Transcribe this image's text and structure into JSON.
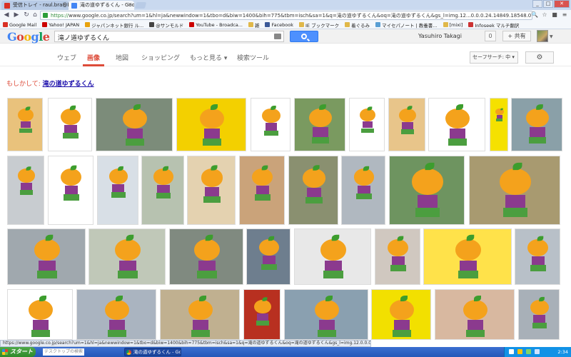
{
  "browser": {
    "tabs": [
      {
        "label": "受信トレイ - raul.bra@biglobe..."
      },
      {
        "label": "滝の道ゆずるくん - Google 画像..."
      }
    ],
    "url_scheme": "https://",
    "url_rest": "www.google.co.jp/search?um=1&hl=ja&newwindow=1&tbo=d&biw=1400&bih=775&tbm=isch&sa=1&q=滝の道ゆずるくん&oq=滝の道ゆずるくん&gs_l=img.12...0.0.0.24.14849.18548.0.21.0.15.11.11.0.0.0.0.077.671.11.11.0...0.0...",
    "bookmarks": [
      {
        "label": "Google Mail",
        "color": "#d93025"
      },
      {
        "label": "Yahoo! JAPAN",
        "color": "#cc0000"
      },
      {
        "label": "ジャパンネット銀行 ル...",
        "color": "#e8a30f"
      },
      {
        "label": "@サンモルド",
        "color": "#444444"
      },
      {
        "label": "YouTube - Broadca...",
        "color": "#cc0000"
      },
      {
        "label": "雑",
        "color": "#e0b84a"
      },
      {
        "label": "Facebook",
        "color": "#3b5998"
      },
      {
        "label": "IE ブックマーク",
        "color": "#e0b84a"
      },
      {
        "label": "着ぐるみ",
        "color": "#e0b84a"
      },
      {
        "label": "マイセパノート | 教養書...",
        "color": "#5a9fd4"
      },
      {
        "label": "[mixi]",
        "color": "#e0b84a"
      },
      {
        "label": "Infoseek マルチ翻訳",
        "color": "#cc3333"
      }
    ]
  },
  "google": {
    "logo": "Google",
    "query": "滝ノ道ゆずるくん",
    "username": "Yasuhiro Takagi",
    "notification_count": "0",
    "share_label": "+ 共有",
    "tabs": [
      {
        "label": "ウェブ"
      },
      {
        "label": "画像"
      },
      {
        "label": "地図"
      },
      {
        "label": "ショッピング"
      },
      {
        "label": "もっと見る ▾"
      },
      {
        "label": "検索ツール"
      }
    ],
    "safesearch_label": "セーフサーチ: 中 ▾",
    "did_you_mean_prefix": "もしかして: ",
    "did_you_mean_link": "滝の道ゆずるくん"
  },
  "status_url": "https://www.google.co.jp/search?um=1&hl=ja&newwindow=1&tbo=d&biw=1400&bih=775&tbm=isch&sa=1&q=滝の道ゆずるくん&oq=滝の道ゆずるくん&gs_l=img.12.0.0.0.24.14849.18548.0.21.0.15.11.11.0.0.0.0.077.671.11.11.0...0.0...1c.1j4.KbVu0L.Kv...",
  "taskbar": {
    "start_label": "スタート",
    "search_placeholder": "デスクトップの検索",
    "window_item": "滝の道ゆずるくん - Go...",
    "clock": "2:34"
  }
}
